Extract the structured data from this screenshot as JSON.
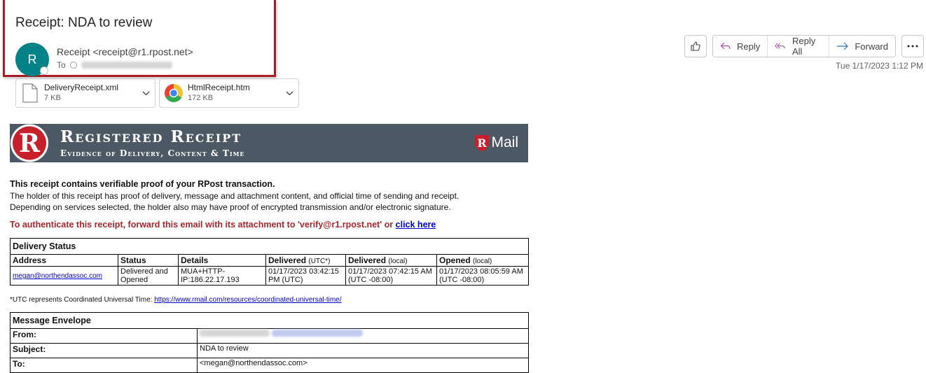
{
  "email": {
    "subject": "Receipt: NDA to review",
    "sender": "Receipt <receipt@r1.rpost.net>",
    "avatar_initial": "R",
    "to_label": "To",
    "timestamp": "Tue 1/17/2023 1:12 PM"
  },
  "actions": {
    "reply": "Reply",
    "reply_all": "Reply All",
    "forward": "Forward"
  },
  "attachments": [
    {
      "name": "DeliveryReceipt.xml",
      "size": "7 KB",
      "icon": "file-icon"
    },
    {
      "name": "HtmlReceipt.htm",
      "size": "172 KB",
      "icon": "chrome-icon"
    }
  ],
  "banner": {
    "title": "Registered Receipt",
    "subtitle": "Evidence of Delivery, Content & Time",
    "brand": "Mail",
    "logo_letter": "R"
  },
  "intro": {
    "lead": "This receipt contains verifiable proof of your RPost transaction.",
    "line1": "The holder of this receipt has proof of delivery, message and attachment content, and official time of sending and receipt.",
    "line2": "Depending on services selected, the holder also may have proof of encrypted transmission and/or electronic signature."
  },
  "verify": {
    "text": "To authenticate this receipt, forward this email with its attachment to 'verify@r1.rpost.net' or ",
    "link": "click here"
  },
  "delivery_status": {
    "title": "Delivery Status",
    "headers": {
      "address": "Address",
      "status": "Status",
      "details": "Details",
      "delivered_utc": "Delivered",
      "delivered_utc_note": "(UTC*)",
      "delivered_local": "Delivered",
      "delivered_local_note": "(local)",
      "opened": "Opened",
      "opened_note": "(local)"
    },
    "row": {
      "address": "megan@northendassoc.com",
      "status": "Delivered and Opened",
      "details": "MUA+HTTP-IP:186.22.17.193",
      "delivered_utc": "01/17/2023 03:42:15 PM (UTC)",
      "delivered_local": "01/17/2023 07:42:15 AM (UTC -08:00)",
      "opened": "01/17/2023 08:05:59 AM (UTC -08:00)"
    }
  },
  "utc_note": {
    "text": "*UTC represents Coordinated Universal Time: ",
    "link": "https://www.rmail.com/resources/coordinated-universal-time/"
  },
  "envelope": {
    "title": "Message Envelope",
    "from_label": "From:",
    "subject_label": "Subject:",
    "subject_value": "NDA to review",
    "to_label": "To:",
    "to_value": "<megan@northendassoc.com>"
  }
}
